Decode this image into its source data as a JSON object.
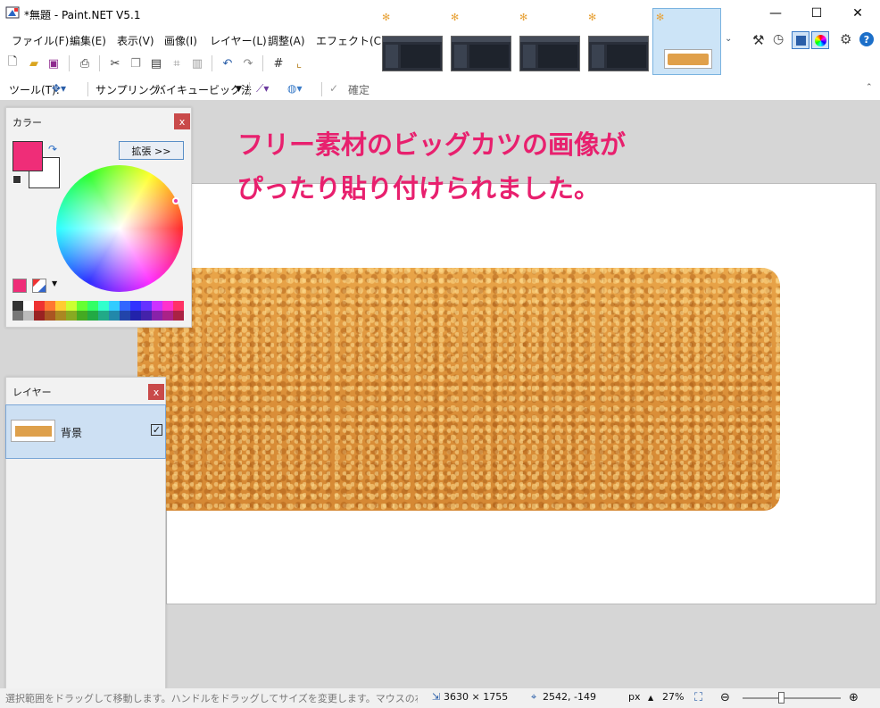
{
  "window": {
    "title": "*無題 - Paint.NET V5.1",
    "minimize": "—",
    "maximize": "☐",
    "close": "✕"
  },
  "menu": [
    "ファイル(F)",
    "編集(E)",
    "表示(V)",
    "画像(I)",
    "レイヤー(L)",
    "調整(A)",
    "エフェクト(C)"
  ],
  "toolbar2": {
    "tool_label": "ツール(T):",
    "sampling_label": "サンプリング:",
    "sampling_value": "バイキュービック法",
    "confirm_label": "確定"
  },
  "annotation": {
    "line1": "フリー素材のビッグカツの画像が",
    "line2": "ぴったり貼り付けられました。"
  },
  "color_panel": {
    "title": "カラー",
    "expand_label": "拡張 >>",
    "close": "x",
    "primary_color": "#ef2d78",
    "secondary_color": "#ffffff"
  },
  "layers_panel": {
    "title": "レイヤー",
    "close": "x",
    "layer_name": "背景"
  },
  "status": {
    "hint": "選択範囲をドラッグして移動します。ハンドルをドラッグしてサイズを変更します。マウスの右ボタンでドラッグして回転します。",
    "image_size": "3630 × 1755",
    "cursor_pos": "2542, -149",
    "unit": "px",
    "zoom": "27%"
  },
  "colors": {
    "accent": "#e8206e",
    "selection": "#cde0f3"
  }
}
